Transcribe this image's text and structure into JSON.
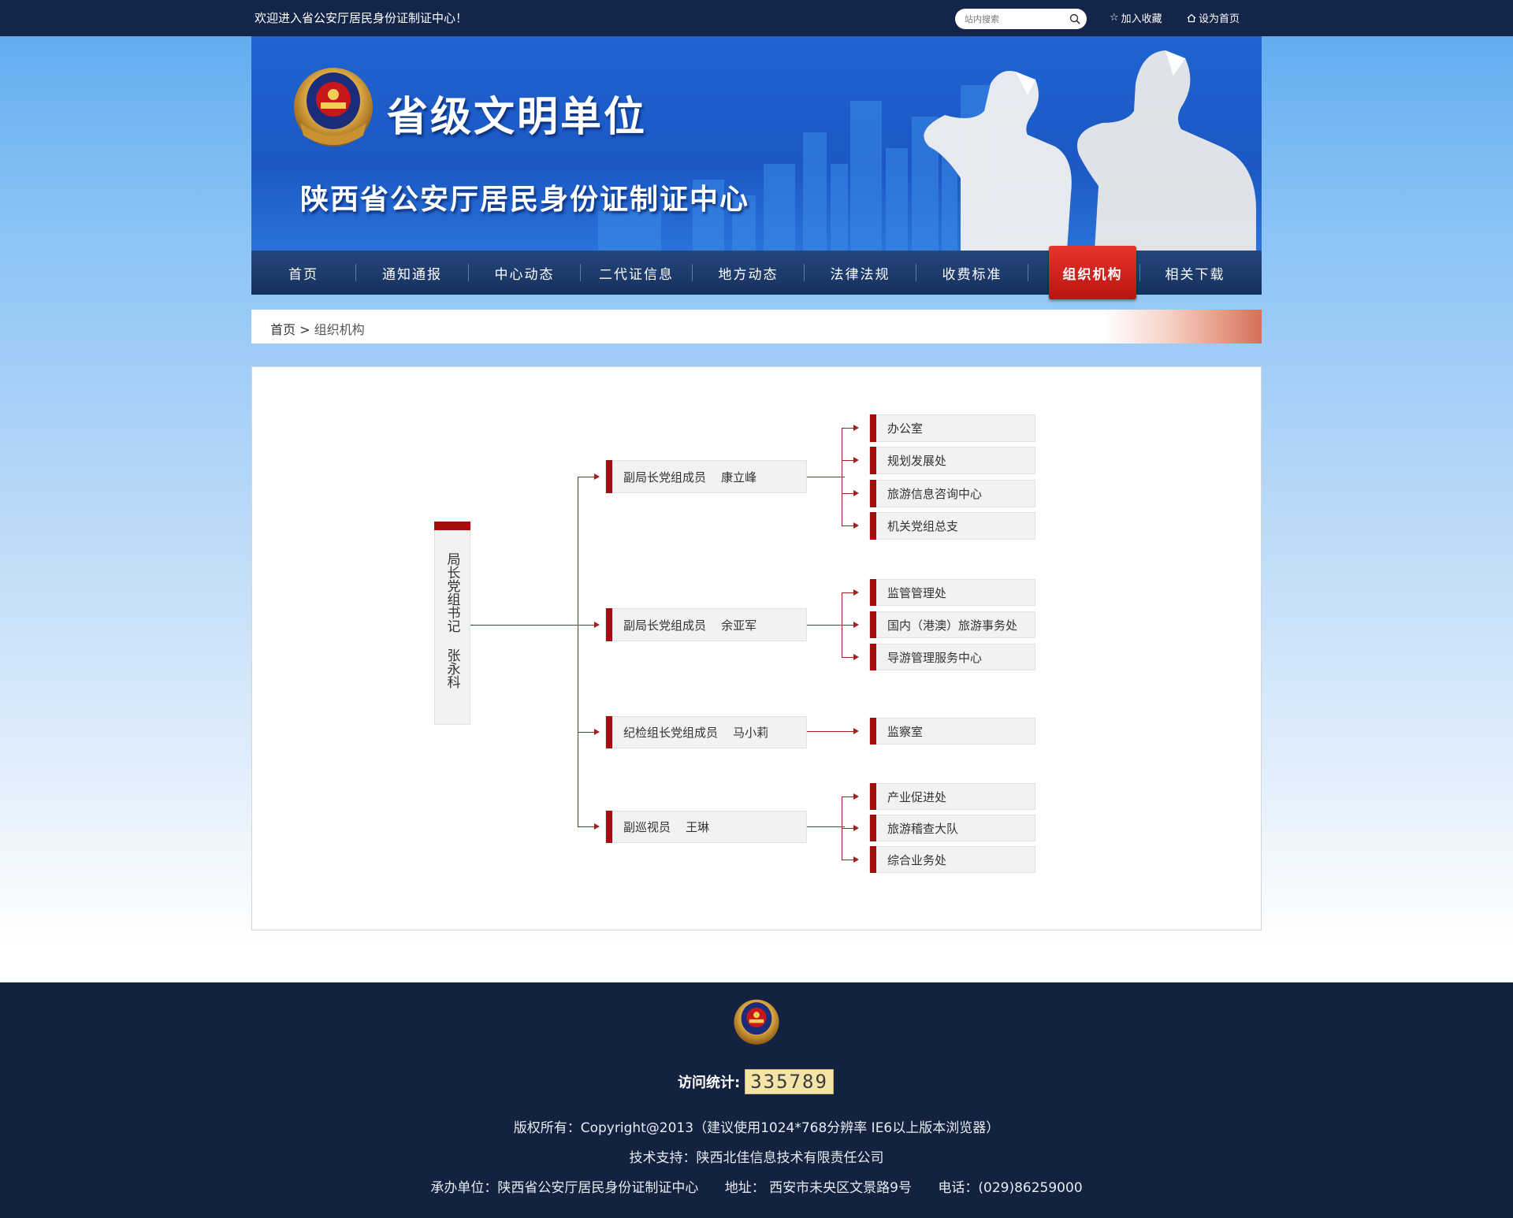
{
  "topbar": {
    "welcome": "欢迎进入省公安厅居民身份证制证中心！",
    "search_placeholder": "站内搜索",
    "bookmark": "加入收藏",
    "homepage": "设为首页"
  },
  "banner": {
    "title1": "省级文明单位",
    "title2": "陕西省公安厅居民身份证制证中心"
  },
  "nav": {
    "items": [
      "首页",
      "通知通报",
      "中心动态",
      "二代证信息",
      "地方动态",
      "法律法规",
      "收费标准",
      "组织机构",
      "相关下载"
    ],
    "active": "组织机构"
  },
  "breadcrumb": {
    "home": "首页",
    "sep": ">",
    "current": "组织机构"
  },
  "org": {
    "root": "局长党组书记  张永科",
    "branches": [
      {
        "label": "副局长党组成员    康立峰",
        "children": [
          "办公室",
          "规划发展处",
          "旅游信息咨询中心",
          "机关党组总支"
        ]
      },
      {
        "label": "副局长党组成员    余亚军",
        "children": [
          "监管管理处",
          "国内（港澳）旅游事务处",
          "导游管理服务中心"
        ]
      },
      {
        "label": "纪检组长党组成员    马小莉",
        "children": [
          "监察室"
        ]
      },
      {
        "label": "副巡视员    王琳",
        "children": [
          "产业促进处",
          "旅游稽查大队",
          "综合业务处"
        ]
      }
    ]
  },
  "footer": {
    "visit_label": "访问统计:",
    "visit_count": "335789",
    "copyright": "版权所有：Copyright@2013（建议使用1024*768分辨率  IE6以上版本浏览器）",
    "tech": "技术支持：陕西北佳信息技术有限责任公司",
    "host": "承办单位：陕西省公安厅居民身份证制证中心",
    "address": "地址：  西安市未央区文景路9号",
    "phone": "电话：(029)86259000"
  },
  "colors": {
    "topbar": "#13264a",
    "nav": "#1c3a6c",
    "active_tab": "#d42a22",
    "accent_red": "#a30d0d",
    "footer": "#13223f"
  }
}
